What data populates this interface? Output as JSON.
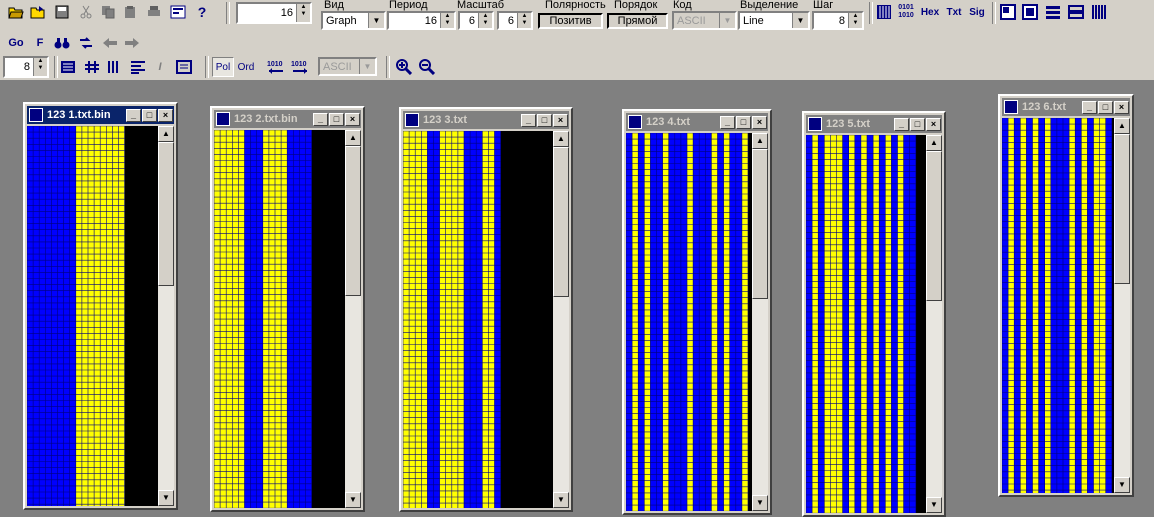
{
  "colors": {
    "blue": "#0000ff",
    "yellow": "#ffff00",
    "black": "#000000",
    "grid": "#000080"
  },
  "toolbar": {
    "row1_icons": [
      "open-icon",
      "reopen-icon",
      "save-icon",
      "cut-icon",
      "copy-icon",
      "paste-icon",
      "print-icon",
      "properties-icon",
      "help-icon"
    ],
    "row1_text_buttons": {
      "bits": "0101\n1010",
      "hex": "Hex",
      "txt": "Txt",
      "sig": "Sig"
    },
    "count_value": "16",
    "view": {
      "label": "Вид",
      "value": "Graph"
    },
    "period": {
      "label": "Период",
      "value": "16"
    },
    "scale": {
      "label": "Масштаб",
      "value1": "6",
      "value2": "6"
    },
    "polarity": {
      "label": "Полярность",
      "button": "Позитив"
    },
    "order": {
      "label": "Порядок",
      "button": "Прямой"
    },
    "code": {
      "label": "Код",
      "value": "ASCII"
    },
    "selection": {
      "label": "Выделение",
      "value": "Line"
    },
    "step": {
      "label": "Шаг",
      "value": "8"
    },
    "row2": {
      "go": "Go",
      "f": "F"
    },
    "row3": {
      "step_value": "8",
      "pol": "Pol",
      "ord": "Ord",
      "code_value": "ASCII"
    }
  },
  "windows": [
    {
      "title": "123 1.txt.bin",
      "active": true,
      "stripes": [
        "B",
        "B",
        "B",
        "B",
        "B",
        "B",
        "B",
        "B",
        "Y",
        "Y",
        "Y",
        "Y",
        "Y",
        "Y",
        "Y",
        "Y"
      ]
    },
    {
      "title": "123 2.txt.bin",
      "active": false,
      "stripes": [
        "Y",
        "Y",
        "Y",
        "Y",
        "Y",
        "B",
        "B",
        "B",
        "Y",
        "Y",
        "Y",
        "Y",
        "B",
        "B",
        "B",
        "B"
      ]
    },
    {
      "title": "123 3.txt",
      "active": false,
      "stripes": [
        "Y",
        "Y",
        "Y",
        "Y",
        "B",
        "B",
        "Y",
        "Y",
        "Y",
        "Y",
        "B",
        "B",
        "B",
        "Y",
        "Y",
        "B"
      ]
    },
    {
      "title": "123 4.txt",
      "active": false,
      "stripes": [
        "B",
        "Y",
        "B",
        "Y",
        "B",
        "B",
        "Y",
        "B",
        "B",
        "B",
        "Y",
        "B",
        "B",
        "B",
        "Y",
        "B",
        "Y",
        "B",
        "B",
        "Y"
      ]
    },
    {
      "title": "123 5.txt",
      "active": false,
      "stripes": [
        "B",
        "Y",
        "B",
        "Y",
        "Y",
        "Y",
        "B",
        "Y",
        "B",
        "Y",
        "B",
        "Y",
        "B",
        "Y",
        "B",
        "Y",
        "B",
        "B"
      ]
    },
    {
      "title": "123 6.txt",
      "active": false,
      "stripes": [
        "B",
        "Y",
        "B",
        "Y",
        "B",
        "Y",
        "B",
        "Y",
        "B",
        "B",
        "B",
        "Y",
        "B",
        "Y",
        "B",
        "Y",
        "Y",
        "B"
      ]
    }
  ]
}
